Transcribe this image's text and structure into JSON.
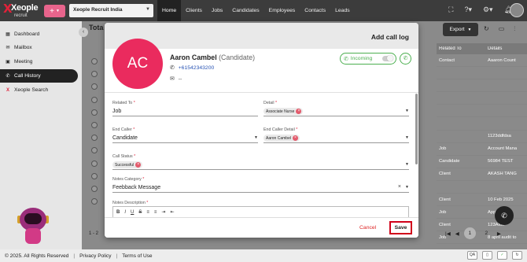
{
  "topbar": {
    "logo_text": "Xeople",
    "logo_sub": "recruit",
    "plus": "+",
    "agency": "Xeople Recruit India",
    "nav": [
      "Home",
      "Clients",
      "Jobs",
      "Candidates",
      "Employees",
      "Contacts",
      "Leads"
    ],
    "active_nav": "Home",
    "icons": [
      "expand-icon",
      "help-icon",
      "settings-icon",
      "bell-icon"
    ]
  },
  "sidebar": {
    "items": [
      {
        "label": "Dashboard",
        "icon": "dashboard-icon"
      },
      {
        "label": "Mailbox",
        "icon": "mail-icon"
      },
      {
        "label": "Meeting",
        "icon": "meeting-icon"
      },
      {
        "label": "Call History",
        "icon": "phone-icon"
      },
      {
        "label": "Xeople Search",
        "icon": "x-search-icon"
      }
    ],
    "active": "Call History"
  },
  "background": {
    "title": "Tota",
    "export_label": "Export",
    "table_headers": [
      "Related To",
      "Details"
    ],
    "rows": [
      [
        "Contact",
        "Aaaron Count"
      ],
      [
        "",
        ""
      ],
      [
        "",
        ""
      ],
      [
        "",
        ""
      ],
      [
        "",
        ""
      ],
      [
        "",
        ""
      ],
      [
        "",
        "1123ddfdsa"
      ],
      [
        "Job",
        "Account Mana"
      ],
      [
        "Candidate",
        "56984 TEST"
      ],
      [
        "Client",
        "AKASH TANG"
      ],
      [
        "",
        ""
      ],
      [
        "Client",
        "10 Feb 2025"
      ],
      [
        "Job",
        "Applications"
      ],
      [
        "Client",
        "123Alok"
      ],
      [
        "Job",
        "8 april audit to"
      ]
    ],
    "page_info": "1 - 2",
    "pages": [
      "1",
      "2"
    ],
    "current_page": "2"
  },
  "footer": {
    "copyright": "© 2025. All Rights Reserved",
    "privacy": "Privacy Policy",
    "terms": "Terms of Use"
  },
  "modal": {
    "title": "Add call log",
    "avatar_initials": "AC",
    "name": "Aaron Cambel",
    "type": "(Candidate)",
    "phone": "+61542343200",
    "email": "--",
    "direction": "Incoming",
    "fields": {
      "related_to": {
        "label": "Related To",
        "value": "Job"
      },
      "detail": {
        "label": "Detail",
        "chip": "Associate Nurse"
      },
      "end_caller": {
        "label": "End Caller",
        "value": "Candidate"
      },
      "end_caller_detail": {
        "label": "End Caller Detail",
        "chip": "Aaron Cambel"
      },
      "call_status": {
        "label": "Call Status",
        "chip": "Successful"
      },
      "notes_category": {
        "label": "Notes Category",
        "value": "Feebback Message"
      },
      "notes_description": {
        "label": "Notes Description"
      }
    },
    "editor_tools": [
      "B",
      "I",
      "U",
      "S",
      "≡",
      "≡",
      "⇥",
      "⇤"
    ],
    "cancel_label": "Cancel",
    "save_label": "Save"
  },
  "colors": {
    "accent": "#ea2b5e",
    "save_border": "#d0021b",
    "incoming": "#4caf50"
  }
}
